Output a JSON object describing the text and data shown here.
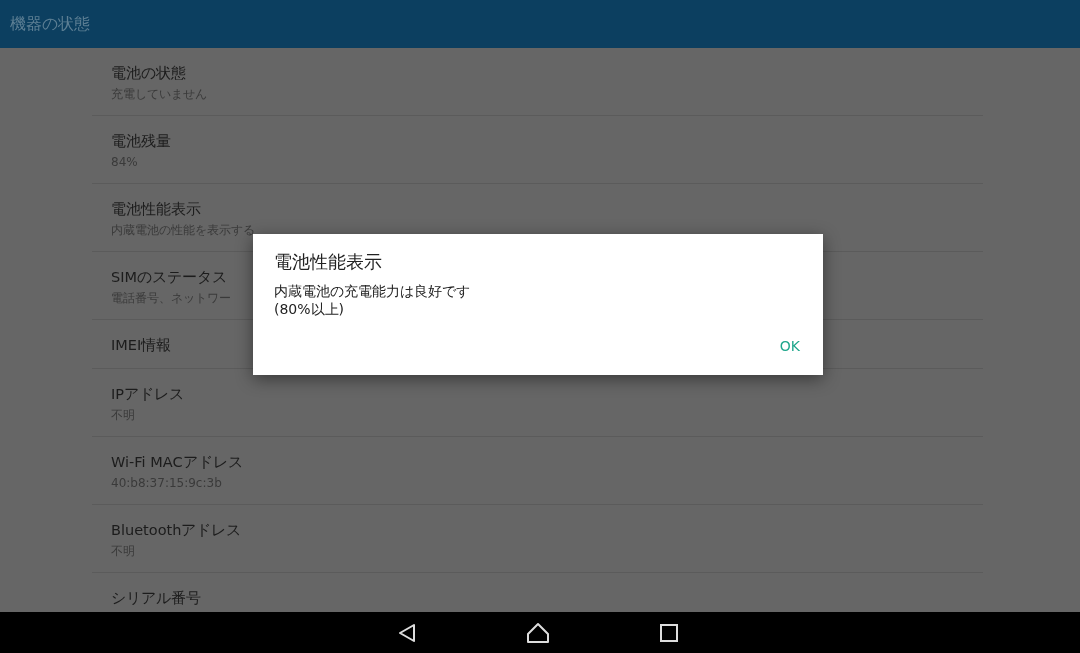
{
  "app_bar": {
    "title": "機器の状態"
  },
  "list": {
    "items": [
      {
        "title": "電池の状態",
        "summary": "充電していません"
      },
      {
        "title": "電池残量",
        "summary": "84%"
      },
      {
        "title": "電池性能表示",
        "summary": "内蔵電池の性能を表示する"
      },
      {
        "title": "SIMのステータス",
        "summary": "電話番号、ネットワー"
      },
      {
        "title": "IMEI情報"
      },
      {
        "title": "IPアドレス",
        "summary": "不明"
      },
      {
        "title": "Wi-Fi MACアドレス",
        "summary": "40:b8:37:15:9c:3b"
      },
      {
        "title": "Bluetoothアドレス",
        "summary": "不明"
      },
      {
        "title": "シリアル番号"
      }
    ]
  },
  "dialog": {
    "title": "電池性能表示",
    "message_lines": [
      "内蔵電池の充電能力は良好です",
      "(80%以上)"
    ],
    "button": "OK"
  }
}
